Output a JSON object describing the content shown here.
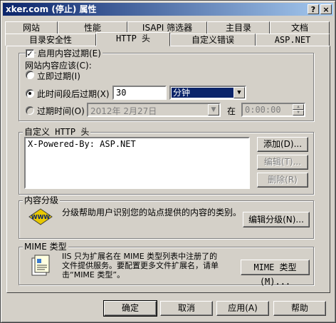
{
  "window": {
    "title": "xker.com (停止) 属性",
    "help_button": "?",
    "close_button": "×"
  },
  "tabs_back": [
    "网站",
    "性能",
    "ISAPI 筛选器",
    "主目录",
    "文档"
  ],
  "tabs_front": [
    "目录安全性",
    "HTTP 头",
    "自定义错误",
    "ASP.NET"
  ],
  "expiry": {
    "enable_label": "启用内容过期(E)",
    "enabled": true,
    "should_label": "网站内容应该(C):",
    "immediate_label": "立即过期(I)",
    "after_label": "此时间段后过期(X)",
    "after_value": "30",
    "unit_value": "分钟",
    "on_label": "过期时间(O)",
    "date_value": "2012年 2月27日",
    "at_label": "在",
    "time_value": "0:00:00"
  },
  "custom_headers": {
    "legend": "自定义 HTTP 头",
    "items": [
      "X-Powered-By: ASP.NET"
    ],
    "add_label": "添加(D)...",
    "edit_label": "编辑(T)...",
    "delete_label": "删除(R)"
  },
  "rating": {
    "legend": "内容分级",
    "description": "分级帮助用户识别您的站点提供的内容的类别。",
    "edit_label": "编辑分级(N)...",
    "icon": "content-rating-icon"
  },
  "mime": {
    "legend": "MIME 类型",
    "description": "IIS 只为扩展名在 MIME 类型列表中注册了的文件提供服务。要配置更多文件扩展名，请单击“MIME 类型”。",
    "button_label": "MIME 类型(M)...",
    "icon": "mime-types-icon"
  },
  "footer": {
    "ok": "确定",
    "cancel": "取消",
    "apply": "应用(A)",
    "help": "帮助"
  },
  "colors": {
    "title_start": "#0a246a",
    "title_end": "#a6caf0",
    "face": "#d4d0c8",
    "selection": "#0a246a"
  }
}
